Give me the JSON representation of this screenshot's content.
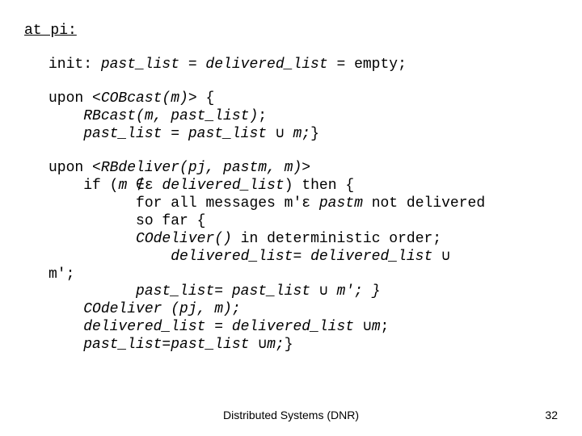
{
  "title": "at pi",
  "init_label": "init: ",
  "init_expr": "past_list = delivered_list",
  "init_tail": " = empty;",
  "upon1_prefix": "upon <",
  "upon1_call": "COBcast(m)",
  "upon1_suffix": "> {",
  "upon1_line1": "RBcast(m, past_list)",
  "upon1_line1_tail": ";",
  "upon1_line2a": "past_list = past_list ",
  "upon1_line2b": " m;",
  "upon1_close": "}",
  "upon2_prefix": "upon <",
  "upon2_call": "RBdeliver(pj, pastm, m)",
  "upon2_suffix": ">",
  "upon2_if_a": "if (",
  "upon2_if_b": "m ",
  "upon2_if_c": " delivered_list",
  "upon2_if_d": ") then {",
  "upon2_for_a": "for all messages m'",
  "upon2_for_b": " pastm ",
  "upon2_for_c": "not delivered",
  "upon2_for2": "so far {",
  "upon2_co": "COdeliver()",
  "upon2_co_tail": " in deterministic order;",
  "upon2_dl_a": "delivered_list= delivered_list ",
  "upon2_mprime": "m';",
  "upon2_pl_a": "past_list= past_list ",
  "upon2_pl_b": " m'; }",
  "upon2_codeliver": "COdeliver (pj, m);",
  "upon2_dl2_a": "delivered_list = delivered_list ",
  "upon2_dl2_b": "m",
  "upon2_dl2_c": ";",
  "upon2_pl2_a": "past_list=past_list ",
  "upon2_pl2_b": "m;",
  "upon2_pl2_c": "}",
  "cup": "∪",
  "notin": "∉ε",
  "in": "ε",
  "footer_left": "Distributed Systems (DNR)",
  "footer_right": "32"
}
